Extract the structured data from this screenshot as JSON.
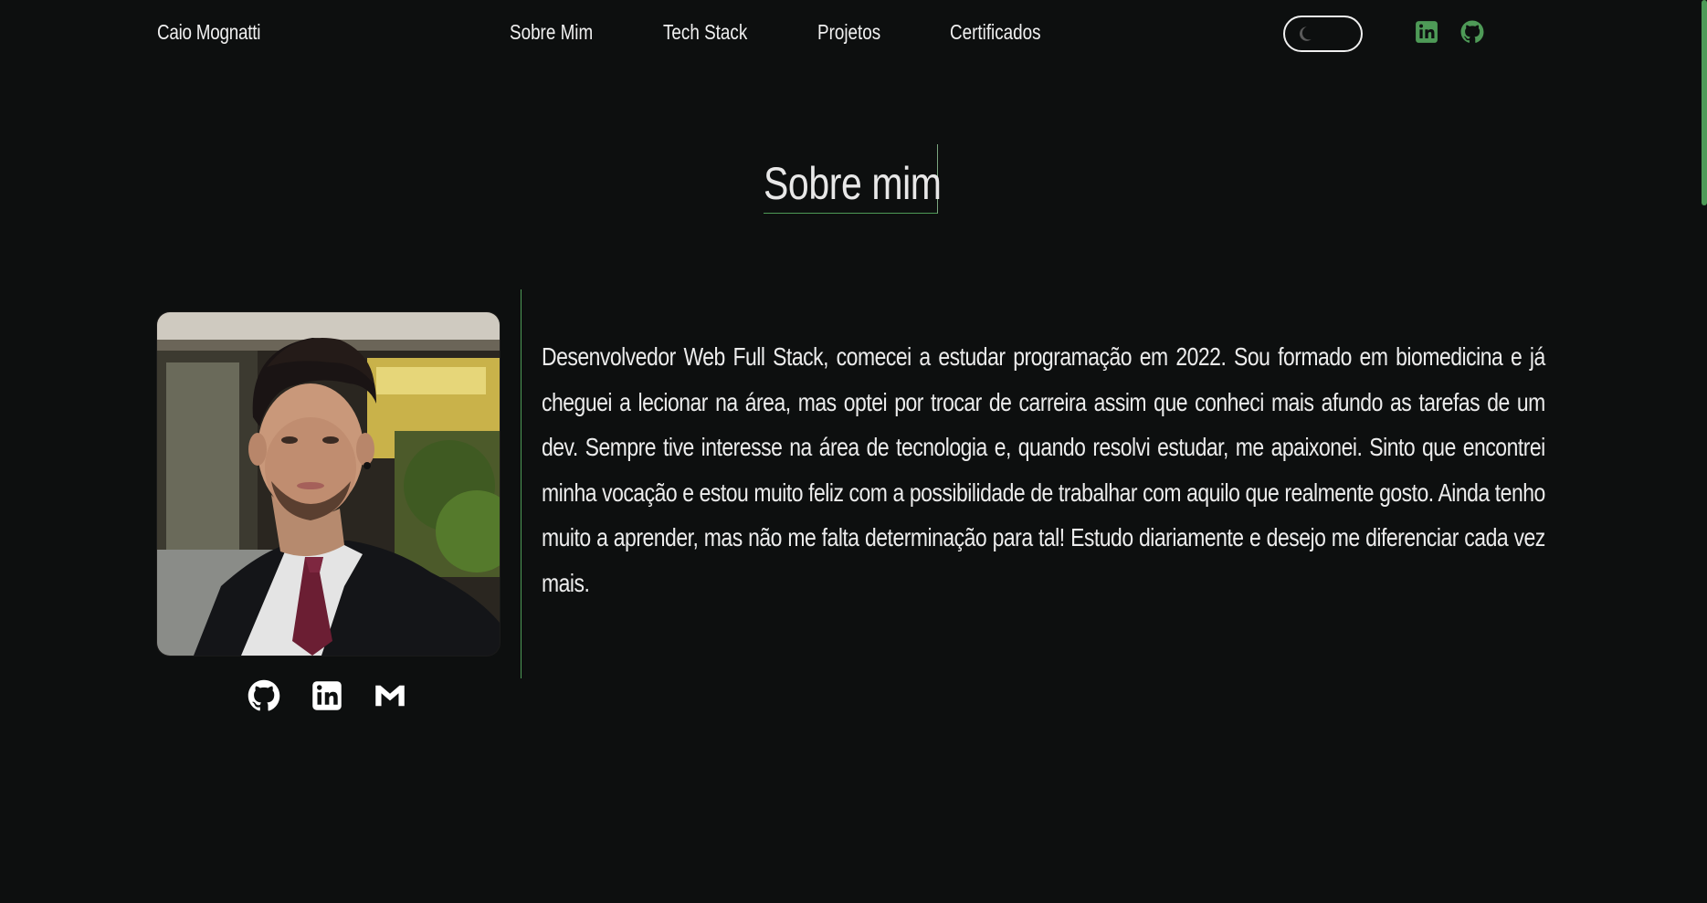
{
  "nav": {
    "brand": "Caio Mognatti",
    "links": [
      {
        "label": "Sobre Mim"
      },
      {
        "label": "Tech Stack"
      },
      {
        "label": "Projetos"
      },
      {
        "label": "Certificados"
      }
    ],
    "theme_toggle": {
      "icon": "moon-icon"
    },
    "social": [
      {
        "icon": "linkedin-icon",
        "color": "#4e9a57"
      },
      {
        "icon": "github-icon",
        "color": "#4e9a57"
      }
    ]
  },
  "section": {
    "title": "Sobre mim",
    "about_text": "Desenvolvedor Web Full Stack, comecei a estudar programação em 2022. Sou formado em biomedicina e já cheguei a lecionar na área, mas optei por trocar de carreira assim que conheci mais afundo as tarefas de um dev. Sempre tive interesse na área de tecnologia e, quando resolvi estudar, me apaixonei. Sinto que encontrei minha vocação e estou muito feliz com a possibilidade de trabalhar com aquilo que realmente gosto. Ainda tenho muito a aprender, mas não me falta determinação para tal! Estudo diariamente e desejo me diferenciar cada vez mais.",
    "social": [
      {
        "icon": "github-icon"
      },
      {
        "icon": "linkedin-icon"
      },
      {
        "icon": "gmail-icon"
      }
    ]
  },
  "colors": {
    "background": "#0d0f0f",
    "accent": "#4e9a57",
    "text": "#ececec"
  }
}
